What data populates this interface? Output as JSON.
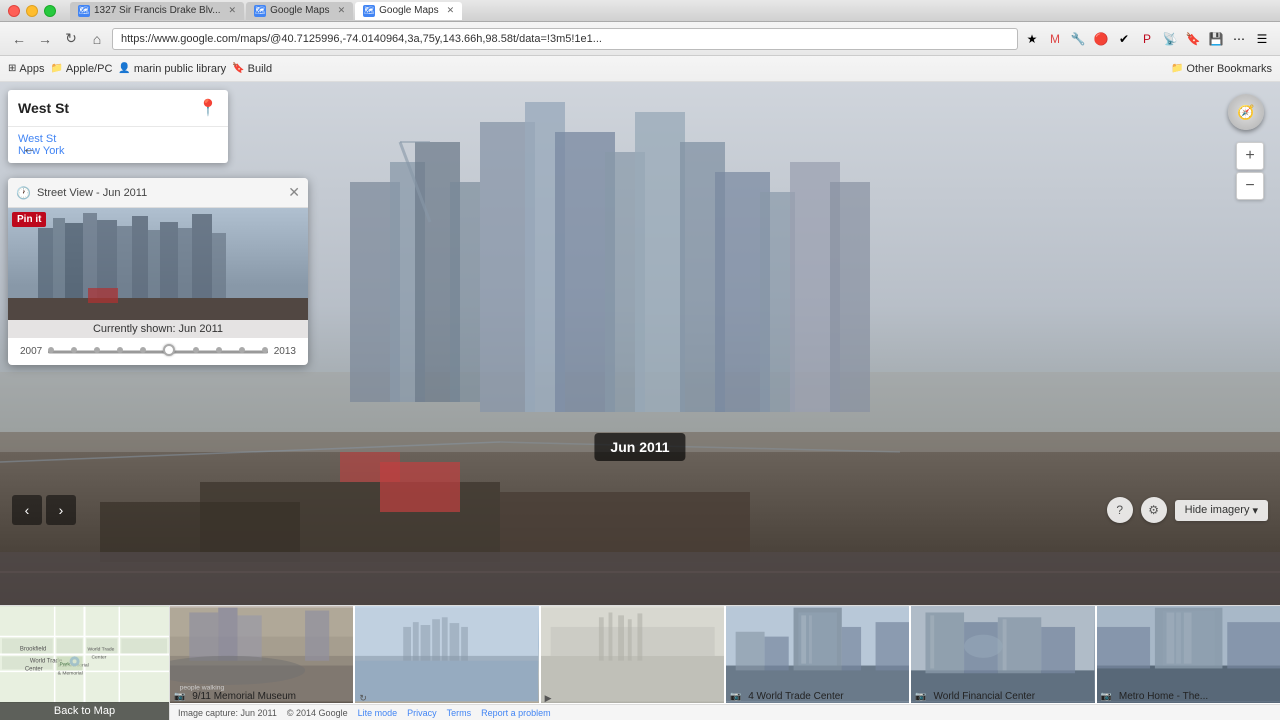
{
  "browser": {
    "traffic_lights": [
      "red",
      "yellow",
      "green"
    ],
    "tabs": [
      {
        "label": "1327 Sir Francis Drake Blv...",
        "active": false,
        "favicon": "map"
      },
      {
        "label": "Google Maps",
        "active": false,
        "favicon": "map"
      },
      {
        "label": "Google Maps",
        "active": true,
        "favicon": "map"
      }
    ],
    "address": "https://www.google.com/maps/@40.7125996,-74.0140964,3a,75y,143.66h,98.58t/data=!3m5!1e1...",
    "back": "←",
    "forward": "→",
    "refresh": "↻",
    "home": "⌂"
  },
  "bookmarks": {
    "apps_label": "Apps",
    "items": [
      {
        "label": "Apple/PC",
        "icon": "📁"
      },
      {
        "label": "marin public library",
        "icon": "👤"
      },
      {
        "label": "Build",
        "icon": "🔖"
      },
      {
        "label": "Other Bookmarks",
        "icon": "📁"
      }
    ]
  },
  "location_panel": {
    "title": "West St",
    "street": "West St",
    "city": "New York",
    "pin_icon": "📍"
  },
  "sv_panel": {
    "title": "Street View - Jun 2011",
    "clock_icon": "🕐",
    "close_icon": "✕",
    "currently_shown": "Currently shown: Jun 2011",
    "pinit_label": "Pin it",
    "timeline": {
      "start": "2007",
      "end": "2013",
      "dots": 10,
      "active_index": 5
    }
  },
  "time_badge": {
    "label": "Jun 2011"
  },
  "controls": {
    "zoom_in": "+",
    "zoom_out": "−",
    "compass": "⊕",
    "prev_arrow": "‹",
    "next_arrow": "›",
    "help_icon": "?",
    "settings_icon": "⚙",
    "hide_imagery_label": "Hide imagery",
    "hide_imagery_chevron": "▾"
  },
  "filmstrip": {
    "back_to_map": "Back to Map",
    "footer": {
      "capture": "Image capture: Jun 2011",
      "copyright": "© 2014 Google",
      "lite_mode": "Lite mode",
      "privacy": "Privacy",
      "terms": "Terms",
      "report": "Report a problem"
    },
    "items": [
      {
        "label": "9/11 Memorial Museum",
        "icon": "📷"
      },
      {
        "label": "",
        "icon": "↻"
      },
      {
        "label": "",
        "icon": "▶"
      },
      {
        "label": "4 World Trade Center",
        "icon": "📷"
      },
      {
        "label": "World Financial Center",
        "icon": "📷"
      },
      {
        "label": "Metro Home - The...",
        "icon": "📷"
      }
    ]
  }
}
